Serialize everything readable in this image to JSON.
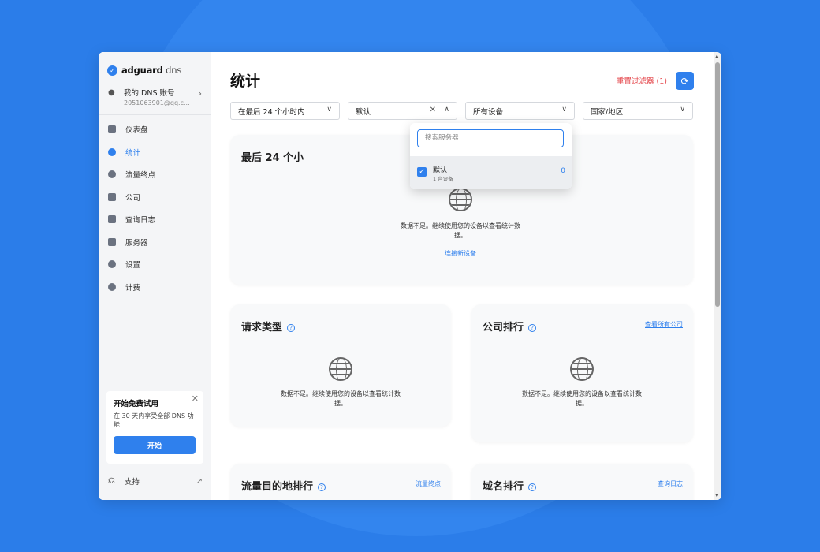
{
  "sidebar": {
    "brand": "adguard",
    "brand_suffix": " dns",
    "account_name": "我的 DNS 账号",
    "account_email": "2051063901@qq.c...",
    "items": [
      {
        "label": "仪表盘"
      },
      {
        "label": "统计"
      },
      {
        "label": "流量终点"
      },
      {
        "label": "公司"
      },
      {
        "label": "查询日志"
      },
      {
        "label": "服务器"
      },
      {
        "label": "设置"
      },
      {
        "label": "计费"
      }
    ],
    "trial": {
      "title": "开始免费试用",
      "desc": "在 30 天内享受全部 DNS 功能",
      "button": "开始"
    },
    "support": "支持"
  },
  "main": {
    "title": "统计",
    "reset": "重置过滤器 (1)",
    "filters": {
      "period": "在最后 24 个小时内",
      "server": "默认",
      "devices": "所有设备",
      "country": "国家/地区"
    },
    "dropdown": {
      "search_placeholder": "搜索服务器",
      "item_name": "默认",
      "item_sub": "1 台设备",
      "item_count": "0"
    },
    "cards": {
      "last24_title": "最后 24 个小",
      "empty": "数据不足。继续使用您的设备以查看统计数据。",
      "connect": "连接新设备",
      "request_types": "请求类型",
      "companies": "公司排行",
      "companies_link": "查看所有公司",
      "destinations": "流量目的地排行",
      "destinations_link": "流量终点",
      "domains": "域名排行",
      "domains_link": "查询日志"
    }
  }
}
